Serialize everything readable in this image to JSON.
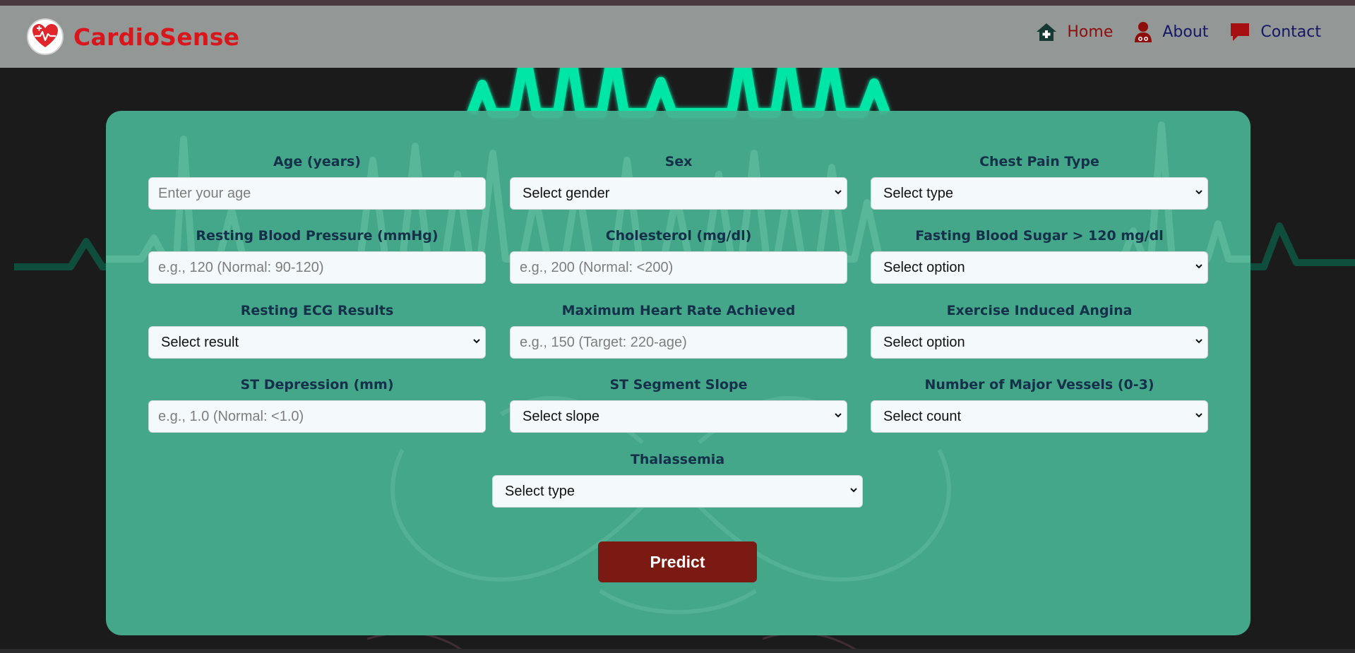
{
  "brand": {
    "name": "CardioSense",
    "logo_icon": "heart-pulse-icon"
  },
  "nav": [
    {
      "label": "Home",
      "icon": "home-icon",
      "color": "#8e0d0d"
    },
    {
      "label": "About",
      "icon": "doctor-icon",
      "color": "#141866"
    },
    {
      "label": "Contact",
      "icon": "chat-icon",
      "color": "#141866"
    }
  ],
  "form": {
    "age": {
      "label": "Age (years)",
      "placeholder": "Enter your age"
    },
    "sex": {
      "label": "Sex",
      "value": "Select gender"
    },
    "chest_pain": {
      "label": "Chest Pain Type",
      "value": "Select type"
    },
    "resting_bp": {
      "label": "Resting Blood Pressure (mmHg)",
      "placeholder": "e.g., 120 (Normal: 90-120)"
    },
    "cholesterol": {
      "label": "Cholesterol (mg/dl)",
      "placeholder": "e.g., 200 (Normal: <200)"
    },
    "fasting_bs": {
      "label": "Fasting Blood Sugar > 120 mg/dl",
      "value": "Select option"
    },
    "resting_ecg": {
      "label": "Resting ECG Results",
      "value": "Select result"
    },
    "max_hr": {
      "label": "Maximum Heart Rate Achieved",
      "placeholder": "e.g., 150 (Target: 220-age)"
    },
    "exercise_angina": {
      "label": "Exercise Induced Angina",
      "value": "Select option"
    },
    "st_depression": {
      "label": "ST Depression (mm)",
      "placeholder": "e.g., 1.0 (Normal: <1.0)"
    },
    "st_slope": {
      "label": "ST Segment Slope",
      "value": "Select slope"
    },
    "major_vessels": {
      "label": "Number of Major Vessels (0-3)",
      "value": "Select count"
    },
    "thalassemia": {
      "label": "Thalassemia",
      "value": "Select type"
    },
    "predict_label": "Predict"
  },
  "colors": {
    "brand": "#d8161c",
    "navbar": "#939795",
    "card": "#47b291",
    "predict": "#7a1a12",
    "background": "#1b1b1c",
    "ecg_glow": "#00e6a6"
  }
}
